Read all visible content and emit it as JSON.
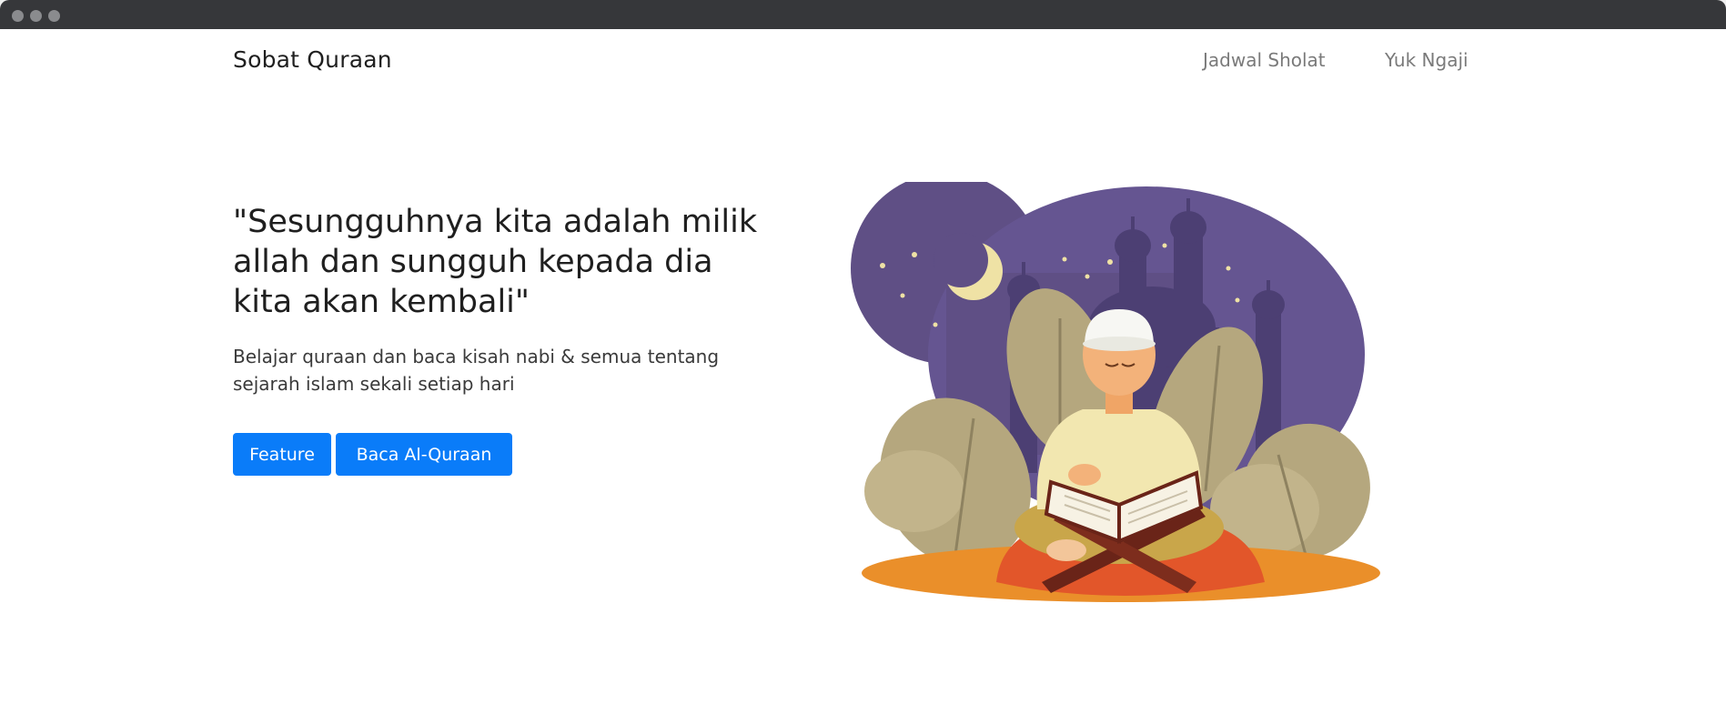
{
  "window": {
    "controls": [
      "close",
      "minimize",
      "maximize"
    ]
  },
  "navbar": {
    "brand": "Sobat Quraan",
    "links": [
      {
        "label": "Jadwal Sholat"
      },
      {
        "label": "Yuk Ngaji"
      }
    ]
  },
  "hero": {
    "title": "\"Sesungguhnya kita adalah milik allah dan sungguh kepada dia kita akan kembali\"",
    "subtitle": "Belajar quraan dan baca kisah nabi & semua tentang sejarah islam sekali setiap hari",
    "buttons": [
      {
        "label": "Feature"
      },
      {
        "label": "Baca Al-Quraan"
      }
    ]
  },
  "illustration": {
    "subject": "boy-reading-quran-icon",
    "colors": {
      "night_sky": "#5f4f85",
      "moon": "#efe2a5",
      "leaves": "#b5a77e",
      "carpet": "#e2562a",
      "button_primary": "#0a7cf9"
    }
  }
}
